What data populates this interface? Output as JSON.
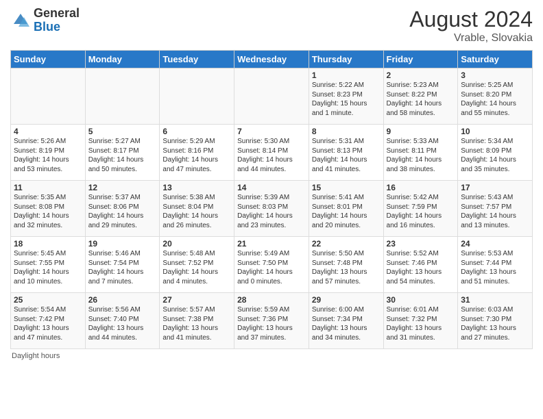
{
  "header": {
    "logo_general": "General",
    "logo_blue": "Blue",
    "month_year": "August 2024",
    "location": "Vrable, Slovakia"
  },
  "days_of_week": [
    "Sunday",
    "Monday",
    "Tuesday",
    "Wednesday",
    "Thursday",
    "Friday",
    "Saturday"
  ],
  "footnote": "Daylight hours",
  "weeks": [
    [
      {
        "day": "",
        "info": ""
      },
      {
        "day": "",
        "info": ""
      },
      {
        "day": "",
        "info": ""
      },
      {
        "day": "",
        "info": ""
      },
      {
        "day": "1",
        "info": "Sunrise: 5:22 AM\nSunset: 8:23 PM\nDaylight: 15 hours\nand 1 minute."
      },
      {
        "day": "2",
        "info": "Sunrise: 5:23 AM\nSunset: 8:22 PM\nDaylight: 14 hours\nand 58 minutes."
      },
      {
        "day": "3",
        "info": "Sunrise: 5:25 AM\nSunset: 8:20 PM\nDaylight: 14 hours\nand 55 minutes."
      }
    ],
    [
      {
        "day": "4",
        "info": "Sunrise: 5:26 AM\nSunset: 8:19 PM\nDaylight: 14 hours\nand 53 minutes."
      },
      {
        "day": "5",
        "info": "Sunrise: 5:27 AM\nSunset: 8:17 PM\nDaylight: 14 hours\nand 50 minutes."
      },
      {
        "day": "6",
        "info": "Sunrise: 5:29 AM\nSunset: 8:16 PM\nDaylight: 14 hours\nand 47 minutes."
      },
      {
        "day": "7",
        "info": "Sunrise: 5:30 AM\nSunset: 8:14 PM\nDaylight: 14 hours\nand 44 minutes."
      },
      {
        "day": "8",
        "info": "Sunrise: 5:31 AM\nSunset: 8:13 PM\nDaylight: 14 hours\nand 41 minutes."
      },
      {
        "day": "9",
        "info": "Sunrise: 5:33 AM\nSunset: 8:11 PM\nDaylight: 14 hours\nand 38 minutes."
      },
      {
        "day": "10",
        "info": "Sunrise: 5:34 AM\nSunset: 8:09 PM\nDaylight: 14 hours\nand 35 minutes."
      }
    ],
    [
      {
        "day": "11",
        "info": "Sunrise: 5:35 AM\nSunset: 8:08 PM\nDaylight: 14 hours\nand 32 minutes."
      },
      {
        "day": "12",
        "info": "Sunrise: 5:37 AM\nSunset: 8:06 PM\nDaylight: 14 hours\nand 29 minutes."
      },
      {
        "day": "13",
        "info": "Sunrise: 5:38 AM\nSunset: 8:04 PM\nDaylight: 14 hours\nand 26 minutes."
      },
      {
        "day": "14",
        "info": "Sunrise: 5:39 AM\nSunset: 8:03 PM\nDaylight: 14 hours\nand 23 minutes."
      },
      {
        "day": "15",
        "info": "Sunrise: 5:41 AM\nSunset: 8:01 PM\nDaylight: 14 hours\nand 20 minutes."
      },
      {
        "day": "16",
        "info": "Sunrise: 5:42 AM\nSunset: 7:59 PM\nDaylight: 14 hours\nand 16 minutes."
      },
      {
        "day": "17",
        "info": "Sunrise: 5:43 AM\nSunset: 7:57 PM\nDaylight: 14 hours\nand 13 minutes."
      }
    ],
    [
      {
        "day": "18",
        "info": "Sunrise: 5:45 AM\nSunset: 7:55 PM\nDaylight: 14 hours\nand 10 minutes."
      },
      {
        "day": "19",
        "info": "Sunrise: 5:46 AM\nSunset: 7:54 PM\nDaylight: 14 hours\nand 7 minutes."
      },
      {
        "day": "20",
        "info": "Sunrise: 5:48 AM\nSunset: 7:52 PM\nDaylight: 14 hours\nand 4 minutes."
      },
      {
        "day": "21",
        "info": "Sunrise: 5:49 AM\nSunset: 7:50 PM\nDaylight: 14 hours\nand 0 minutes."
      },
      {
        "day": "22",
        "info": "Sunrise: 5:50 AM\nSunset: 7:48 PM\nDaylight: 13 hours\nand 57 minutes."
      },
      {
        "day": "23",
        "info": "Sunrise: 5:52 AM\nSunset: 7:46 PM\nDaylight: 13 hours\nand 54 minutes."
      },
      {
        "day": "24",
        "info": "Sunrise: 5:53 AM\nSunset: 7:44 PM\nDaylight: 13 hours\nand 51 minutes."
      }
    ],
    [
      {
        "day": "25",
        "info": "Sunrise: 5:54 AM\nSunset: 7:42 PM\nDaylight: 13 hours\nand 47 minutes."
      },
      {
        "day": "26",
        "info": "Sunrise: 5:56 AM\nSunset: 7:40 PM\nDaylight: 13 hours\nand 44 minutes."
      },
      {
        "day": "27",
        "info": "Sunrise: 5:57 AM\nSunset: 7:38 PM\nDaylight: 13 hours\nand 41 minutes."
      },
      {
        "day": "28",
        "info": "Sunrise: 5:59 AM\nSunset: 7:36 PM\nDaylight: 13 hours\nand 37 minutes."
      },
      {
        "day": "29",
        "info": "Sunrise: 6:00 AM\nSunset: 7:34 PM\nDaylight: 13 hours\nand 34 minutes."
      },
      {
        "day": "30",
        "info": "Sunrise: 6:01 AM\nSunset: 7:32 PM\nDaylight: 13 hours\nand 31 minutes."
      },
      {
        "day": "31",
        "info": "Sunrise: 6:03 AM\nSunset: 7:30 PM\nDaylight: 13 hours\nand 27 minutes."
      }
    ]
  ]
}
